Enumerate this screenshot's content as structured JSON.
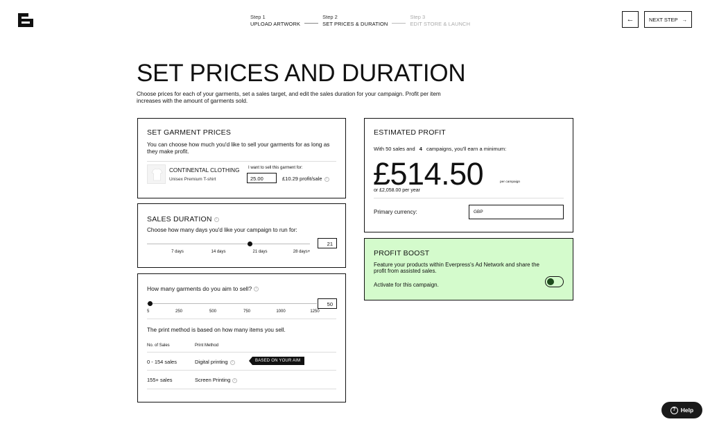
{
  "header": {
    "steps": [
      {
        "num": "Step 1",
        "label": "UPLOAD ARTWORK"
      },
      {
        "num": "Step 2",
        "label": "SET PRICES & DURATION"
      },
      {
        "num": "Step 3",
        "label": "EDIT STORE & LAUNCH"
      }
    ],
    "back_icon": "arrow-left-icon",
    "next_label": "NEXT STEP",
    "next_icon": "arrow-right-icon"
  },
  "page": {
    "title": "SET PRICES AND DURATION",
    "description": "Choose prices for each of your garments, set a sales target, and edit the sales duration for your campaign. Profit per item increases with the amount of garments sold."
  },
  "prices": {
    "title": "SET GARMENT PRICES",
    "description": "You can choose how much you'd like to sell your garments for as long as they make profit.",
    "product_name": "CONTINENTAL CLOTHING",
    "product_sub": "Unisex Premium T-shirt",
    "sell_label": "I want to sell this garment for:",
    "price_value": "25.00",
    "profit_sale": "£10.29 profit/sale"
  },
  "duration": {
    "title": "SALES DURATION",
    "description": "Choose how many days you'd like your campaign to run for:",
    "ticks": [
      "7 days",
      "14 days",
      "21 days",
      "28 days+"
    ],
    "value": "21",
    "level": 0.63
  },
  "garments": {
    "question": "How many garments do you aim to sell?",
    "ticks": [
      "5",
      "250",
      "500",
      "750",
      "1000",
      "1250"
    ],
    "value": "50",
    "level": 0.02,
    "print_note": "The print method is based on how many items you sell.",
    "col_sales": "No. of Sales",
    "col_method": "Print Method",
    "rows": [
      {
        "sales": "0 - 154 sales",
        "method": "Digital printing"
      },
      {
        "sales": "155+ sales",
        "method": "Screen Printing"
      }
    ],
    "badge": "BASED ON YOUR AIM"
  },
  "profit": {
    "title": "ESTIMATED PROFIT",
    "earn_prefix": "With 50 sales and",
    "campaigns": "4",
    "earn_suffix": "campaigns, you'll earn a minimum:",
    "amount": "£514.50",
    "per_campaign": "per campaign",
    "per_year": "or £2,058.00 per year",
    "currency_label": "Primary currency:",
    "currency_value": "GBP"
  },
  "boost": {
    "title": "PROFIT BOOST",
    "description": "Feature your products within Everpress's Ad Network and share the profit from assisted sales.",
    "activate_label": "Activate for this campaign.",
    "toggle_on": true,
    "accent": "#d4fbcc"
  },
  "help": {
    "label": "Help"
  }
}
